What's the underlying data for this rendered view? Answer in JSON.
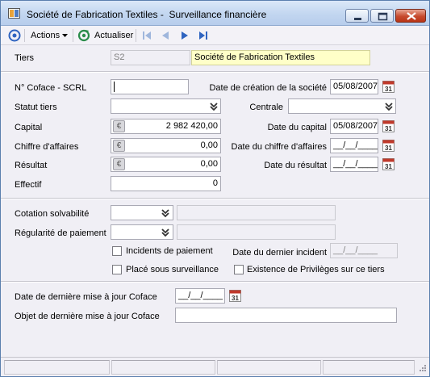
{
  "window": {
    "title": "Société de Fabrication Textiles -  Surveillance financière"
  },
  "toolbar": {
    "actions_label": "Actions",
    "refresh_label": "Actualiser"
  },
  "tiers": {
    "label": "Tiers",
    "code": "S2",
    "name": "Société de Fabrication Textiles"
  },
  "company": {
    "coface_label": "N° Coface - SCRL",
    "coface_value": "",
    "statut_label": "Statut tiers",
    "statut_value": "",
    "capital_label": "Capital",
    "capital_value": "2 982 420,00",
    "ca_label": "Chiffre d'affaires",
    "ca_value": "0,00",
    "resultat_label": "Résultat",
    "resultat_value": "0,00",
    "effectif_label": "Effectif",
    "effectif_value": "0",
    "date_creation_label": "Date de création de la société",
    "date_creation_value": "05/08/2007",
    "centrale_label": "Centrale",
    "centrale_value": "",
    "date_capital_label": "Date du capital",
    "date_capital_value": "05/08/2007",
    "date_ca_label": "Date du chiffre d'affaires",
    "date_ca_value": "__/__/____",
    "date_resultat_label": "Date du résultat",
    "date_resultat_value": "__/__/____"
  },
  "solvency": {
    "cotation_label": "Cotation solvabilité",
    "cotation_value": "",
    "regularite_label": "Régularité de paiement",
    "regularite_value": "",
    "incidents_label": "Incidents de paiement",
    "date_incident_label": "Date du dernier incident",
    "date_incident_value": "__/__/____",
    "surveillance_label": "Placé sous surveillance",
    "privileges_label": "Existence de Privilèges sur ce tiers"
  },
  "coface_update": {
    "date_label": "Date de dernière mise à jour Coface",
    "date_value": "__/__/____",
    "objet_label": "Objet de dernière mise à jour Coface",
    "objet_value": ""
  },
  "calendar_icon_text": "31",
  "euro_icon_text": "€",
  "colors": {
    "accent": "#3a6fc4",
    "close": "#c74b2f",
    "highlight": "#ffffc8",
    "calendar": "#c0392b"
  }
}
